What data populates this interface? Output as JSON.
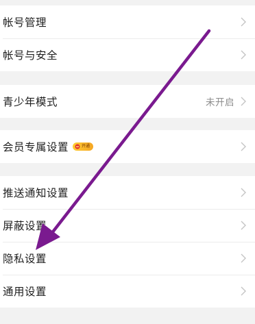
{
  "groups": [
    {
      "items": [
        {
          "label": "帐号管理"
        },
        {
          "label": "帐号与安全"
        }
      ]
    },
    {
      "items": [
        {
          "label": "青少年模式",
          "value": "未开启"
        }
      ]
    },
    {
      "items": [
        {
          "label": "会员专属设置",
          "badge": "开通"
        }
      ]
    },
    {
      "items": [
        {
          "label": "推送通知设置"
        },
        {
          "label": "屏蔽设置"
        },
        {
          "label": "隐私设置"
        },
        {
          "label": "通用设置"
        }
      ]
    }
  ],
  "colors": {
    "annotation_arrow": "#7a1a8f",
    "badge_gradient_start": "#ffcc33",
    "badge_gradient_end": "#f5a623",
    "chevron": "#c4c4c4"
  },
  "icons": {
    "row_chevron": "chevron-right-icon",
    "badge_icon": "vip-crown-icon"
  }
}
